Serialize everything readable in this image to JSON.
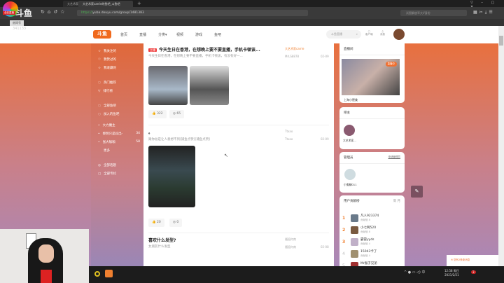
{
  "browser": {
    "tabs": [
      "大艺术家carrie直播_二次元",
      "大艺术家carrie的鱼吧_斗鱼吧"
    ],
    "url_scheme": "https://",
    "url_rest": "yuba.douyu.com/group/1481383",
    "search_placeholder": "试图解放军大V身份"
  },
  "overlay": {
    "logo": "斗鱼",
    "room_label": "房间号",
    "room_id": "341133",
    "badge": "全民直播"
  },
  "header": {
    "nav": [
      "首页",
      "直播",
      "分类▾",
      "视频",
      "游戏",
      "鱼吧"
    ],
    "search_placeholder": "斗鱼直播",
    "client_label": "客户端",
    "message_label": "消息"
  },
  "sidebar": {
    "items": [
      "我关注的",
      "我赞过的",
      "我收藏的",
      "热门推荐",
      "排行榜",
      "全部鱼吧",
      "加入的鱼吧",
      "大力魔主",
      "黎明只是段出-",
      "张大咖咖",
      "更多",
      "全部话题",
      "全部专栏"
    ],
    "counts": [
      "34",
      "58"
    ]
  },
  "posts": [
    {
      "tag": "主播",
      "title": "今天生日在香港，在想晚上要不要直播，手机卡顿该...",
      "summary": "今天生日在香港，在想晚上要不要直播，手机卡顿该，有没有好一...",
      "author": "大艺术家carrie",
      "replier": "MrLS8878",
      "date": "02-09",
      "likes": "322",
      "comments": "65"
    },
    {
      "title": "。",
      "summary": "跟你总是让人意想不到[捕鱼点赞][捕鱼点赞]",
      "author": "Ttxao",
      "replier": "Ttxao",
      "date": "02-09",
      "likes": "20",
      "comments": "0"
    },
    {
      "title": "喜欢什么发型?",
      "summary": "女朋友什么发型",
      "author": "邂逅何南",
      "replier": "邂逅何南",
      "date": "02-08"
    }
  ],
  "right": {
    "live": {
      "title": "直播间",
      "badge": "直播中",
      "name": "上海小肥美"
    },
    "owner": {
      "title": "吧主",
      "name": "大艺术家..."
    },
    "admins": {
      "title": "管理员",
      "apply": "申请管理员",
      "name": "小鬼精011"
    },
    "ranking": {
      "title": "用户贡献榜",
      "tabs": [
        "周",
        "月"
      ],
      "items": [
        {
          "rank": "1",
          "name": "凡人923374",
          "score": "贡献值 8"
        },
        {
          "rank": "2",
          "name": "小七啊520",
          "score": "贡献值 8"
        },
        {
          "rank": "3",
          "name": "霸雷yyds",
          "score": "贡献值 4"
        },
        {
          "rank": "4",
          "name": "15043卡了",
          "score": "贡献值 4"
        },
        {
          "rank": "5",
          "name": "Mr猴子兄弟",
          "score": ""
        }
      ]
    }
  },
  "notice": "您有2条新消息",
  "taskbar": {
    "time": "12:58 周日",
    "date": "2021/2/21",
    "ime": "中",
    "notif_count": "3"
  }
}
